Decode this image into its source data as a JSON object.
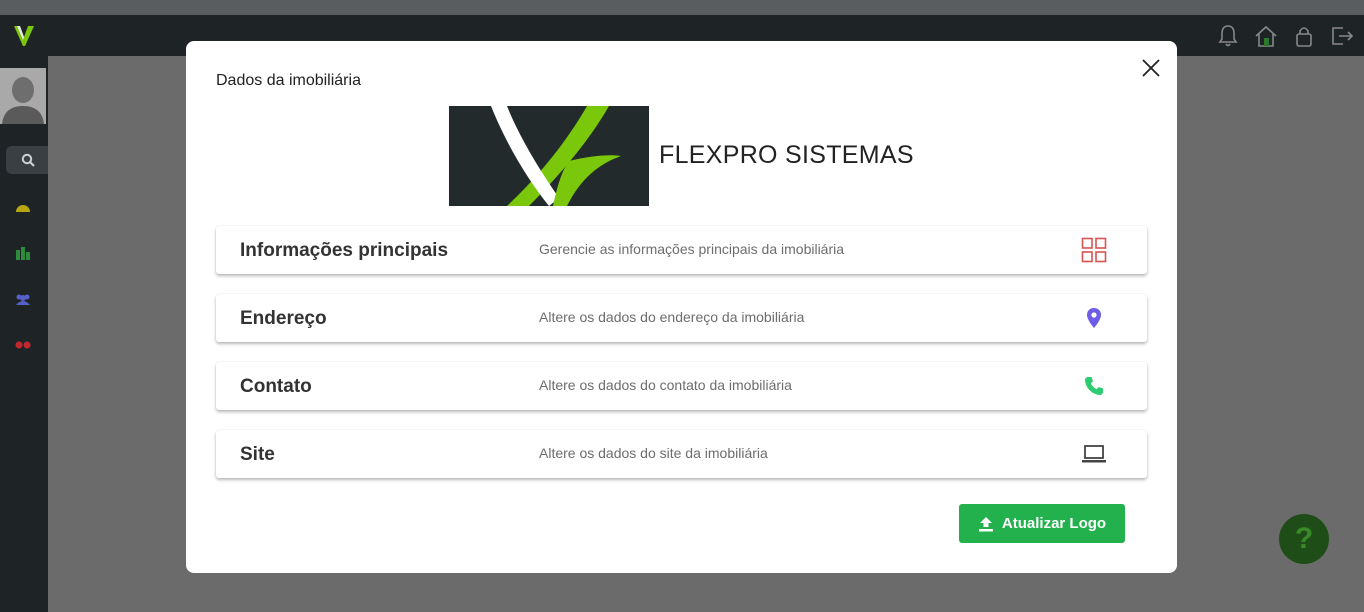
{
  "modal": {
    "title": "Dados da imobiliária",
    "company_name": "FLEXPRO SISTEMAS",
    "cards": [
      {
        "title": "Informações principais",
        "description": "Gerencie as informações principais da imobiliária",
        "icon": "grid-icon",
        "icon_color": "#d9534f"
      },
      {
        "title": "Endereço",
        "description": "Altere os dados do endereço da imobiliária",
        "icon": "map-pin-icon",
        "icon_color": "#6c5ce7"
      },
      {
        "title": "Contato",
        "description": "Altere os dados do contato da imobiliária",
        "icon": "phone-icon",
        "icon_color": "#2ecc71"
      },
      {
        "title": "Site",
        "description": "Altere os dados do site da imobiliária",
        "icon": "laptop-icon",
        "icon_color": "#444444"
      }
    ],
    "update_logo_label": "Atualizar Logo"
  },
  "help": {
    "label": "?"
  },
  "colors": {
    "accent_green": "#22b14c",
    "brand_green": "#7ac70c",
    "dark_bg": "#1e2326"
  }
}
